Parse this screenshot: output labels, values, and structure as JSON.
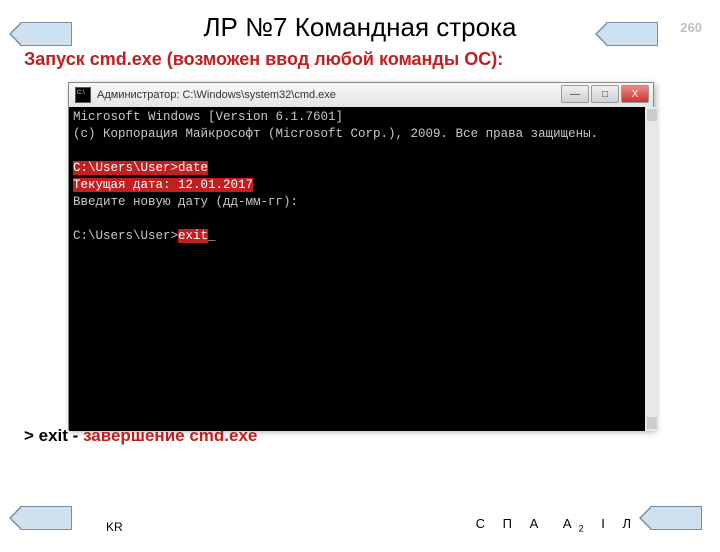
{
  "page_number": "260",
  "title": "ЛР №7 Командная строка",
  "subtitle": "Запуск cmd.exe (возможен ввод любой команды ОС):",
  "window_title": "Администратор: C:\\Windows\\system32\\cmd.exe",
  "console": {
    "line1": "Microsoft Windows [Version 6.1.7601]",
    "line2": "(c) Корпорация Майкрософт (Microsoft Corp.), 2009. Все права защищены.",
    "blank": "",
    "prompt1_pre": "C:\\Users\\User>",
    "cmd1": "date",
    "date_line": "Текущая дата: 12.01.2017",
    "enter_line": "Введите новую дату (дд-мм-гг):",
    "prompt2_pre": "C:\\Users\\User>",
    "cmd2": "exit",
    "cursor": "_"
  },
  "bottom_caption_prefix": "> exit  - ",
  "bottom_caption_red": "завершение cmd.exe",
  "footer": {
    "kr": "KR",
    "l1": "С",
    "l2": "П",
    "l3": "А",
    "l4a": "А",
    "l4b": "2",
    "l5": "I",
    "l6": "Л"
  },
  "win_buttons": {
    "min": "—",
    "max": "□",
    "close": "X"
  }
}
